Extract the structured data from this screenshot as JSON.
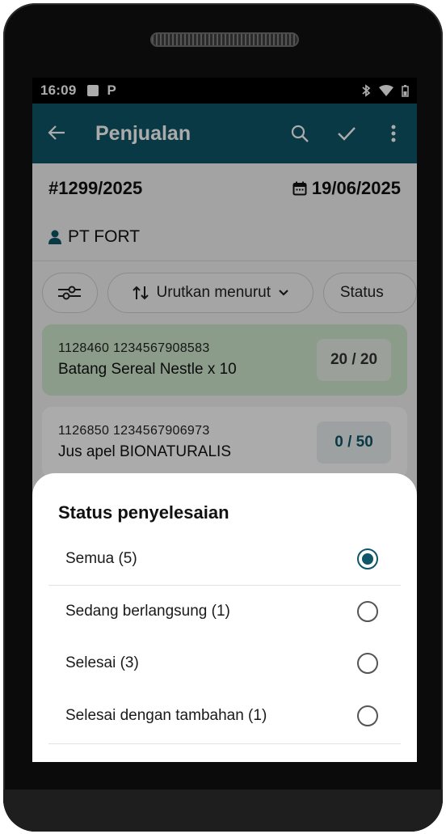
{
  "status_bar": {
    "time": "16:09",
    "p_icon": "P"
  },
  "app_bar": {
    "title": "Penjualan",
    "icons": [
      "back-arrow-icon",
      "search-icon",
      "check-icon",
      "more-vert-icon"
    ],
    "color": "#0e5668"
  },
  "order": {
    "number": "#1299/2025",
    "date": "19/06/2025",
    "customer": "PT FORT"
  },
  "toolbar": {
    "sort_label": "Urutkan menurut",
    "status_label": "Status"
  },
  "items": [
    {
      "code": "1128460 1234567908583",
      "name": "Batang Sereal Nestle x 10",
      "qty": "20 / 20",
      "complete": true
    },
    {
      "code": "1126850 1234567906973",
      "name": "Jus apel BIONATURALIS",
      "qty": "0 / 50",
      "complete": false
    }
  ],
  "sheet": {
    "title": "Status penyelesaian",
    "options": [
      {
        "label": "Semua (5)",
        "selected": true
      },
      {
        "label": "Sedang berlangsung (1)",
        "selected": false
      },
      {
        "label": "Selesai (3)",
        "selected": false
      },
      {
        "label": "Selesai dengan tambahan (1)",
        "selected": false
      }
    ]
  }
}
